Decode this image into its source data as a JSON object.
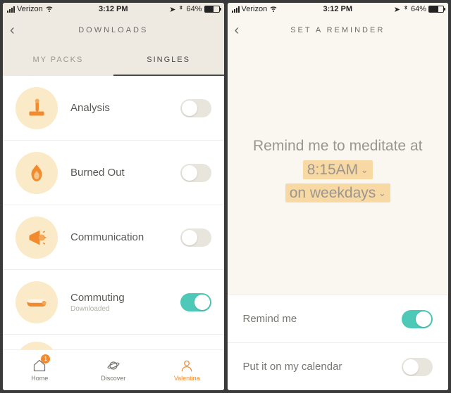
{
  "status": {
    "carrier": "Verizon",
    "time": "3:12 PM",
    "battery_pct": "64%"
  },
  "left": {
    "title": "DOWNLOADS",
    "tabs": [
      {
        "label": "MY PACKS",
        "active": false
      },
      {
        "label": "SINGLES",
        "active": true
      }
    ],
    "items": [
      {
        "title": "Analysis",
        "subtitle": "",
        "on": false,
        "icon": "microscope"
      },
      {
        "title": "Burned Out",
        "subtitle": "",
        "on": false,
        "icon": "fire"
      },
      {
        "title": "Communication",
        "subtitle": "",
        "on": false,
        "icon": "megaphone"
      },
      {
        "title": "Commuting",
        "subtitle": "Downloaded",
        "on": true,
        "icon": "train"
      }
    ],
    "nav": [
      {
        "label": "Home",
        "badge": "1",
        "active": false
      },
      {
        "label": "Discover",
        "badge": "",
        "active": false
      },
      {
        "label": "Valentina",
        "badge": "",
        "active": true
      }
    ]
  },
  "right": {
    "title": "SET A REMINDER",
    "sentence_pre": "Remind me to meditate at ",
    "time": "8:15AM",
    "days": "on weekdays",
    "settings": [
      {
        "label": "Remind me",
        "on": true
      },
      {
        "label": "Put it on my calendar",
        "on": false
      }
    ]
  }
}
